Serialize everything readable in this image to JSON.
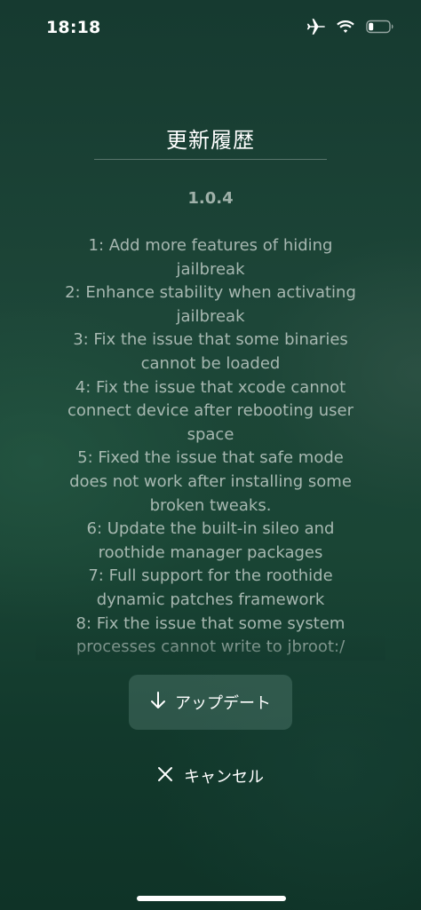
{
  "status_bar": {
    "time": "18:18",
    "icons": [
      "airplane-icon",
      "wifi-icon",
      "battery-icon"
    ]
  },
  "dialog": {
    "title": "更新履歴",
    "version": "1.0.4",
    "notes": [
      "1: Add more features of hiding",
      "jailbreak",
      "2: Enhance stability when activating",
      "jailbreak",
      "3: Fix the issue that some binaries",
      "cannot be loaded",
      "4: Fix the issue that xcode cannot",
      "connect device after rebooting user",
      "space",
      "5: Fixed the issue that safe mode",
      "does not work after installing some",
      "broken tweaks.",
      "6: Update the built-in sileo and",
      "roothide manager packages",
      "7: Full support for the roothide",
      "dynamic patches framework",
      "8: Fix the issue that some system",
      "processes cannot write to jbroot:/"
    ],
    "update_button": {
      "label": "アップデート",
      "icon": "arrow-down-icon"
    },
    "cancel_button": {
      "label": "キャンセル",
      "icon": "close-icon"
    }
  },
  "colors": {
    "background_top": "#163a30",
    "background_bottom": "#0f3327",
    "text_primary": "#ffffff",
    "text_secondary": "#c8d4ce"
  }
}
